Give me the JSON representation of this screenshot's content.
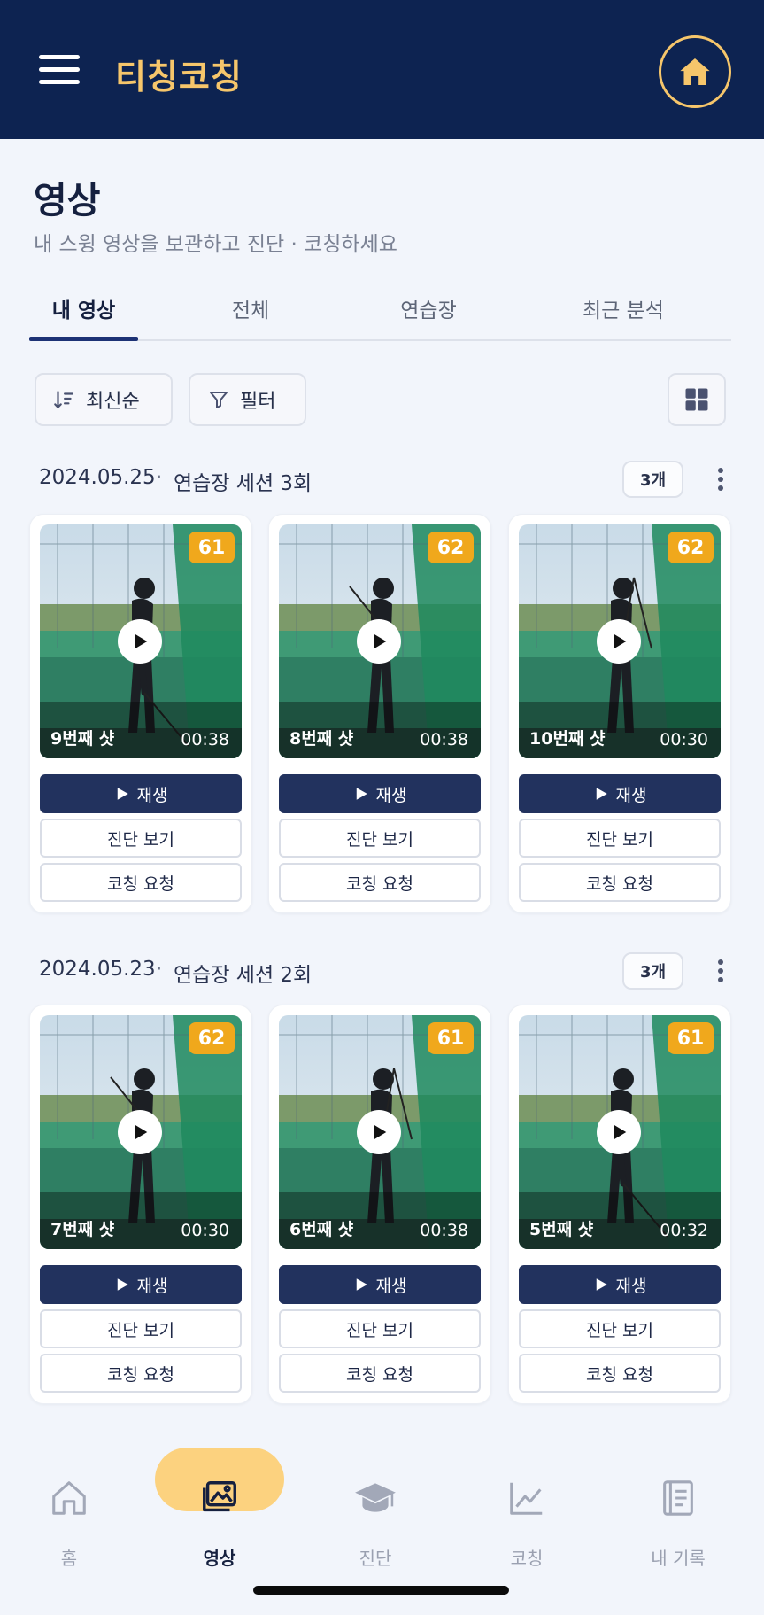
{
  "header": {
    "title": "티칭코칭",
    "menu_icon": "menu-icon",
    "home_icon": "home-icon"
  },
  "page": {
    "title": "영상",
    "subtitle": "내 스윙 영상을 보관하고 진단 · 코칭하세요"
  },
  "tabs": [
    {
      "label": "내 영상",
      "active": true
    },
    {
      "label": "전체",
      "active": false
    },
    {
      "label": "연습장",
      "active": false
    },
    {
      "label": "최근 분석",
      "active": false
    }
  ],
  "toolbar": {
    "sort_label": "최신순",
    "filter_label": "필터",
    "view_icon": "grid-view-icon"
  },
  "sessions": [
    {
      "date": "2024.05.25",
      "separator": "·",
      "name": "연습장 세션 3회",
      "count": "3개",
      "videos": [
        {
          "score": "61",
          "shot": "9번째 샷",
          "duration": "00:38",
          "play_label": "재생",
          "diagnosis_label": "진단 보기",
          "coaching_label": "코칭 요청"
        },
        {
          "score": "62",
          "shot": "8번째 샷",
          "duration": "00:38",
          "play_label": "재생",
          "diagnosis_label": "진단 보기",
          "coaching_label": "코칭 요청"
        },
        {
          "score": "62",
          "shot": "10번째 샷",
          "duration": "00:30",
          "play_label": "재생",
          "diagnosis_label": "진단 보기",
          "coaching_label": "코칭 요청"
        }
      ]
    },
    {
      "date": "2024.05.23",
      "separator": "·",
      "name": "연습장 세션 2회",
      "count": "3개",
      "videos": [
        {
          "score": "62",
          "shot": "7번째 샷",
          "duration": "00:30",
          "play_label": "재생",
          "diagnosis_label": "진단 보기",
          "coaching_label": "코칭 요청"
        },
        {
          "score": "61",
          "shot": "6번째 샷",
          "duration": "00:38",
          "play_label": "재생",
          "diagnosis_label": "진단 보기",
          "coaching_label": "코칭 요청"
        },
        {
          "score": "61",
          "shot": "5번째 샷",
          "duration": "00:32",
          "play_label": "재생",
          "diagnosis_label": "진단 보기",
          "coaching_label": "코칭 요청"
        }
      ]
    }
  ],
  "bottom_nav": [
    {
      "label": "홈",
      "icon": "home-icon",
      "active": false
    },
    {
      "label": "영상",
      "icon": "gallery-icon",
      "active": true
    },
    {
      "label": "진단",
      "icon": "graduation-cap-icon",
      "active": false
    },
    {
      "label": "코칭",
      "icon": "chart-line-icon",
      "active": false
    },
    {
      "label": "내 기록",
      "icon": "document-icon",
      "active": false
    }
  ],
  "colors": {
    "header_bg": "#0d2351",
    "accent_gold": "#f6c66b",
    "score_badge": "#f0a81c",
    "primary_button": "#22325e",
    "nav_active_pill": "#fcd27f"
  }
}
